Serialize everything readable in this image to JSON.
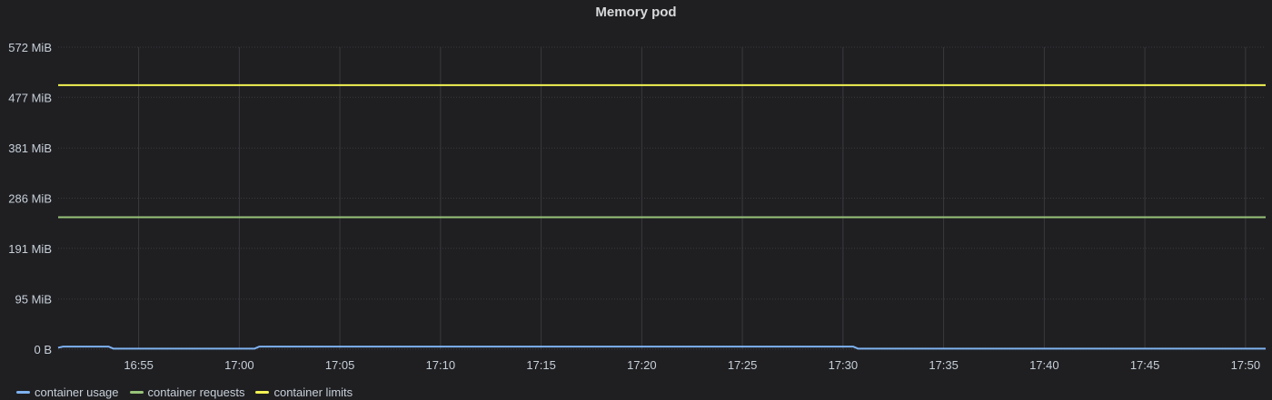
{
  "panel": {
    "title": "Memory pod"
  },
  "legend": [
    {
      "name": "container usage",
      "color": "#7eb2f0"
    },
    {
      "name": "container requests",
      "color": "#98c379"
    },
    {
      "name": "container limits",
      "color": "#f2f252"
    }
  ],
  "chart_data": {
    "type": "line",
    "title": "Memory pod",
    "xlabel": "",
    "ylabel": "",
    "grid": true,
    "legend_position": "bottom-left",
    "y_unit": "MiB",
    "ylim": [
      0,
      572
    ],
    "y_ticks": [
      {
        "value": 0,
        "label": "0 B"
      },
      {
        "value": 95,
        "label": "95 MiB"
      },
      {
        "value": 191,
        "label": "191 MiB"
      },
      {
        "value": 286,
        "label": "286 MiB"
      },
      {
        "value": 381,
        "label": "381 MiB"
      },
      {
        "value": 477,
        "label": "477 MiB"
      },
      {
        "value": 572,
        "label": "572 MiB"
      }
    ],
    "xlim": [
      "16:51",
      "17:51"
    ],
    "x_ticks": [
      "16:55",
      "17:00",
      "17:05",
      "17:10",
      "17:15",
      "17:20",
      "17:25",
      "17:30",
      "17:35",
      "17:40",
      "17:45",
      "17:50"
    ],
    "series": [
      {
        "name": "container usage",
        "color": "#7eb2f0",
        "points": [
          [
            "16:51",
            3
          ],
          [
            "16:51:15",
            5
          ],
          [
            "16:53:30",
            5
          ],
          [
            "16:53:45",
            1
          ],
          [
            "17:00:45",
            1
          ],
          [
            "17:01:00",
            5
          ],
          [
            "17:30:30",
            5
          ],
          [
            "17:30:45",
            1
          ],
          [
            "17:51",
            1
          ]
        ]
      },
      {
        "name": "container requests",
        "color": "#98c379",
        "points": [
          [
            "16:51",
            250
          ],
          [
            "17:51",
            250
          ]
        ]
      },
      {
        "name": "container limits",
        "color": "#f2f252",
        "points": [
          [
            "16:51",
            500
          ],
          [
            "17:51",
            500
          ]
        ]
      }
    ]
  }
}
